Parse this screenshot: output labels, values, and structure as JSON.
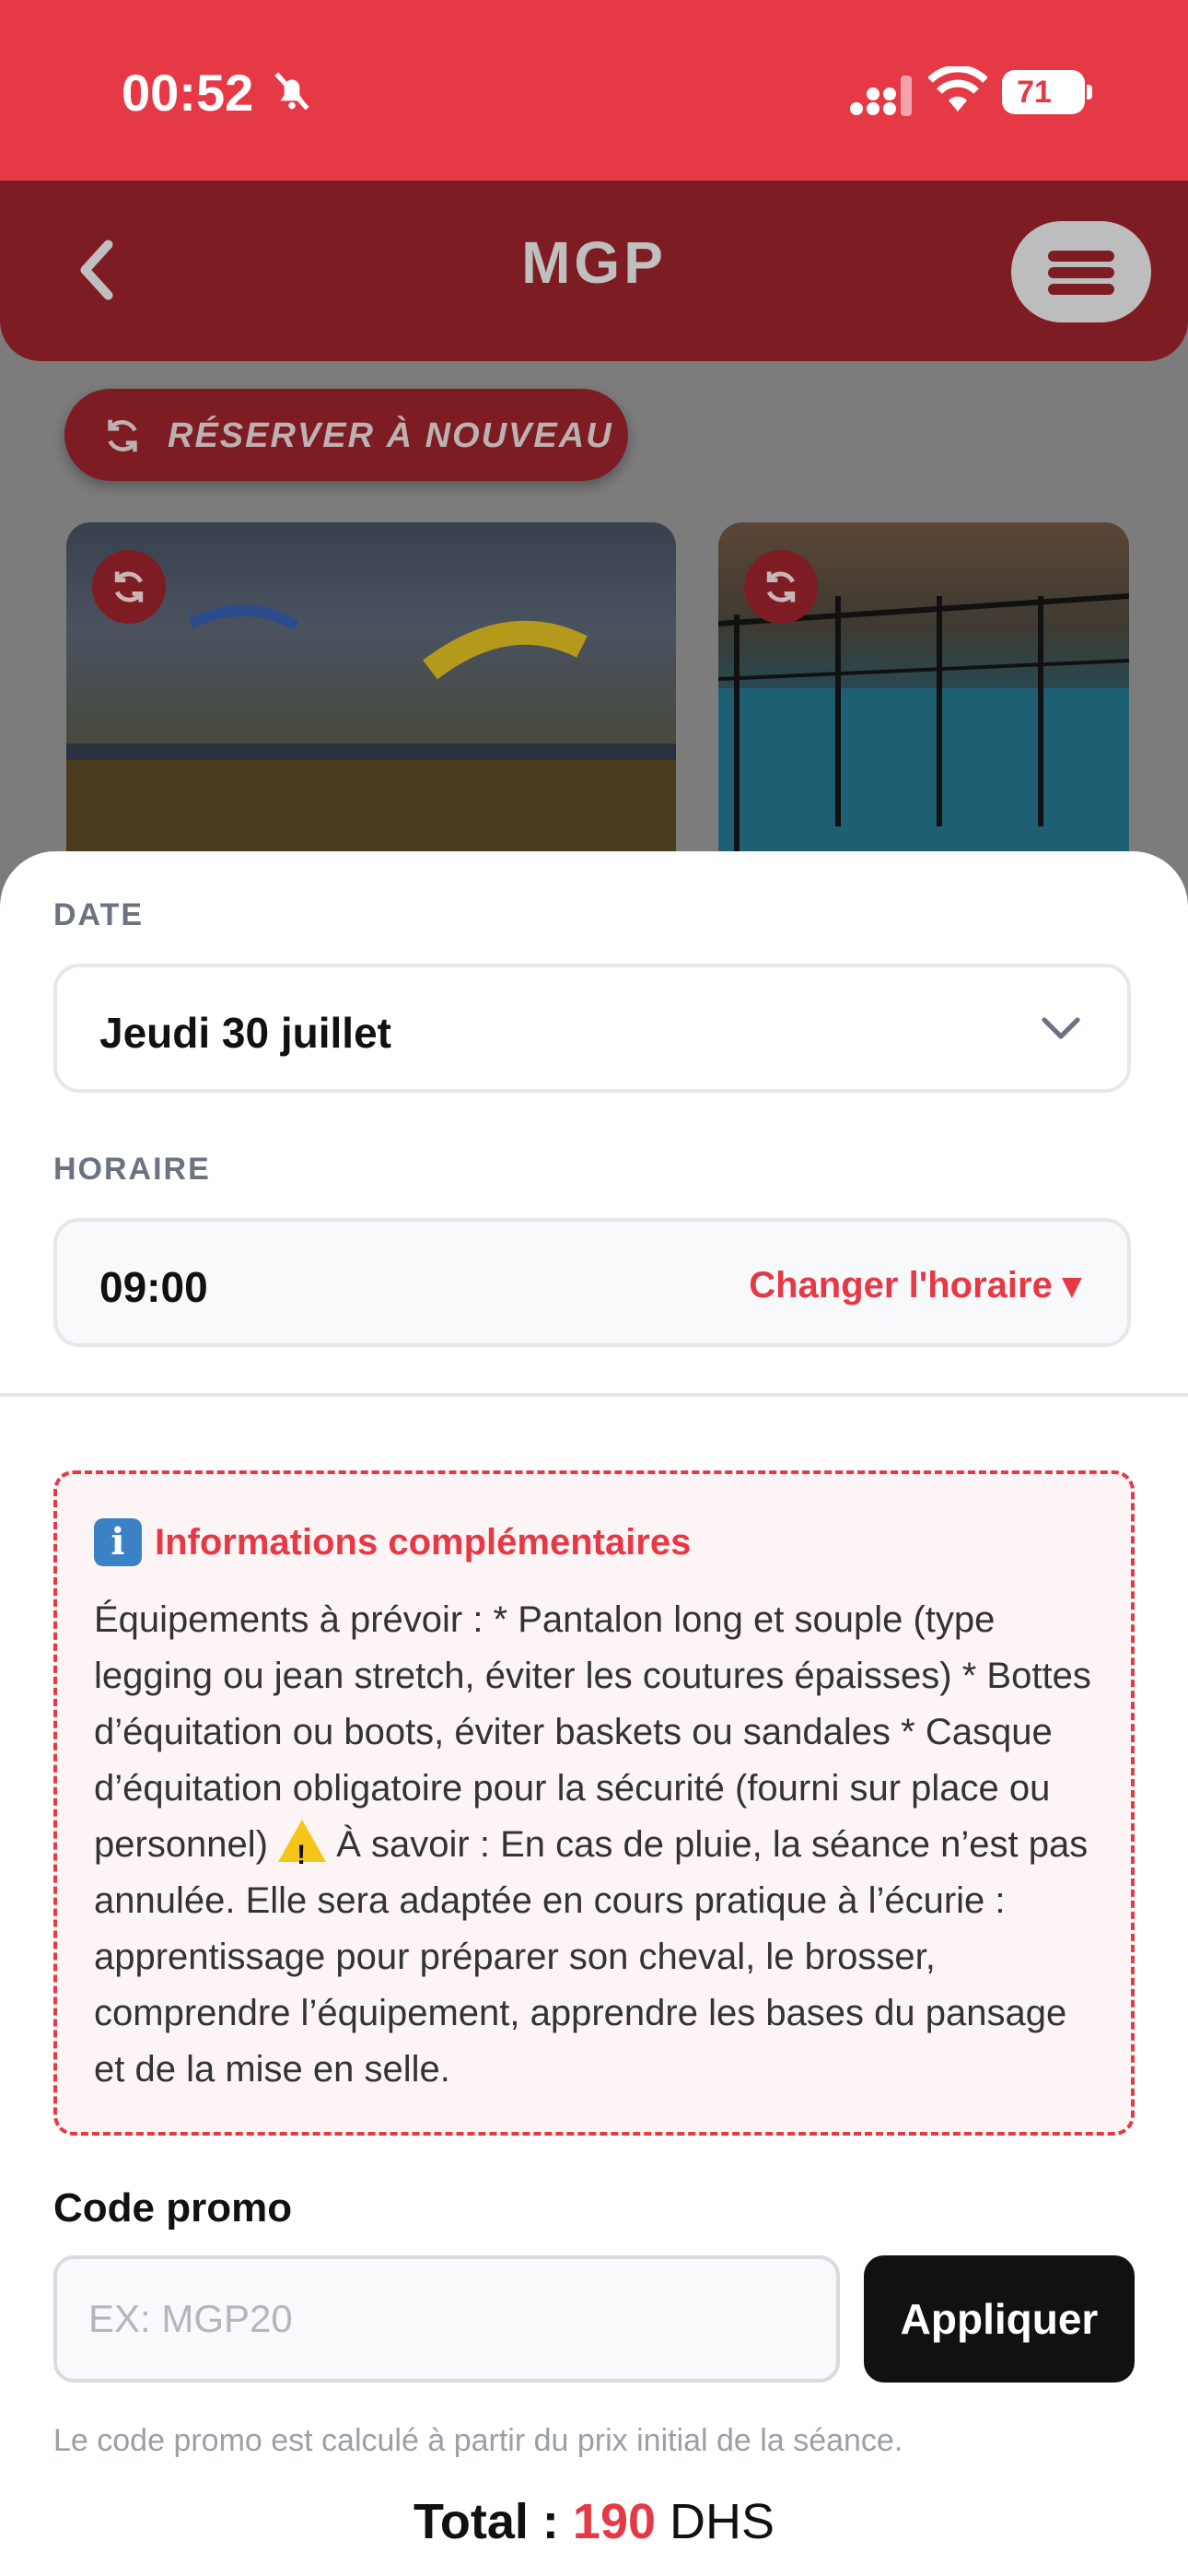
{
  "status_bar": {
    "time": "00:52",
    "battery": "71"
  },
  "header": {
    "title": "MGP"
  },
  "page": {
    "rebook_label": "RÉSERVER  À NOUVEAU"
  },
  "sheet": {
    "date": {
      "label": "DATE",
      "value": "Jeudi 30 juillet"
    },
    "schedule": {
      "label": "HORAIRE",
      "value": "09:00",
      "change_label": "Changer l'horaire ▾"
    },
    "info": {
      "icon": "i",
      "title": "Informations complémentaires",
      "text_part1": "Équipements à prévoir : * Pantalon long et souple (type legging ou jean stretch, éviter les coutures épaisses) * Bottes d’équitation ou boots, éviter baskets ou sandales * Casque d’équitation obligatoire pour la sécurité (fourni sur place ou personnel) ",
      "text_part2": " À savoir : En cas de pluie, la séance n’est pas annulée. Elle sera adaptée en cours pratique à l’écurie : apprentissage pour préparer son cheval, le brosser, comprendre l’équipement, apprendre les bases du pansage et de la mise en selle."
    },
    "promo": {
      "label": "Code promo",
      "placeholder": "EX: MGP20",
      "value": "",
      "apply_label": "Appliquer",
      "note": "Le code promo est calculé à partir du prix initial de la séance."
    },
    "total": {
      "label": "Total : ",
      "amount": "190",
      "currency": " DHS"
    }
  },
  "icons": {
    "back": "chevron-left-icon",
    "menu": "hamburger-menu-icon",
    "rebook": "refresh-icon",
    "chevron": "chevron-down-icon",
    "info": "info-icon",
    "warning": "warning-icon"
  },
  "colors": {
    "accent": "#e63946",
    "header_dim": "#7d1c23",
    "button_dark": "#111111"
  }
}
